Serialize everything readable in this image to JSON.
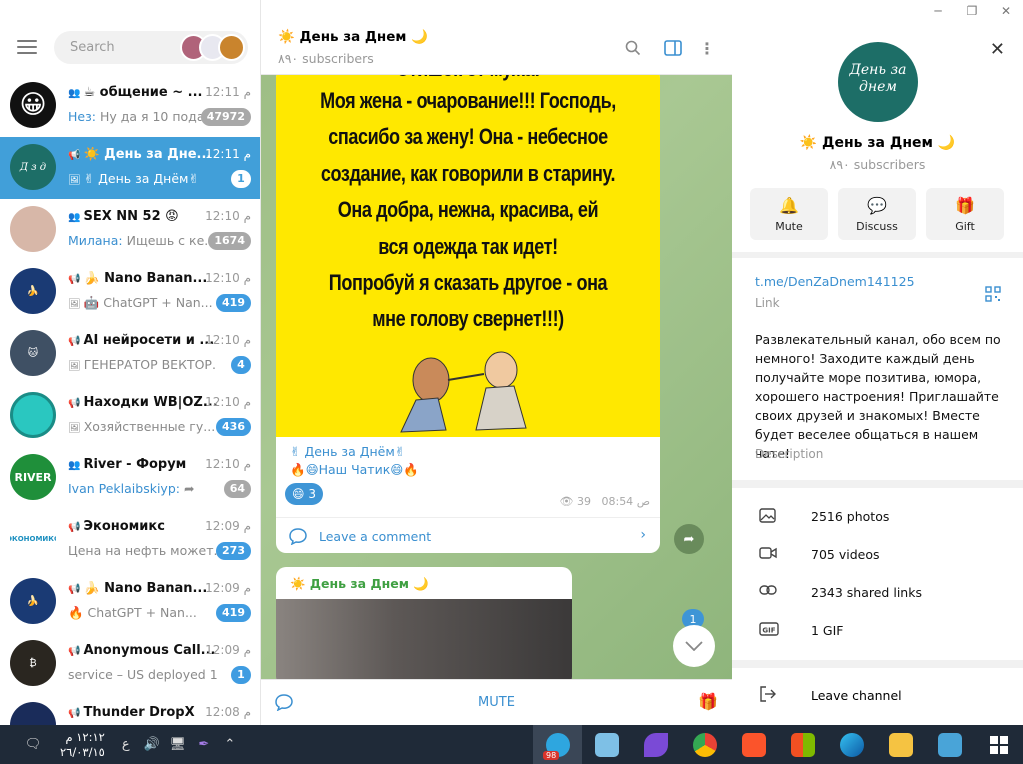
{
  "window": {
    "min": "─",
    "restore": "❐",
    "close": "✕"
  },
  "sidebar": {
    "search_placeholder": "Search",
    "chats": [
      {
        "title": "☕ общение ~ ...",
        "time": "م 12:11",
        "sender": "Нез:",
        "preview": "Ну да я 10 пода...",
        "badge": "47972"
      },
      {
        "title": "☀️ День за Дне...",
        "time": "م 12:11",
        "sender": "",
        "preview": "✌ День за Днём✌",
        "badge": "1"
      },
      {
        "title": "SEX NN 52 😡",
        "time": "م 12:10",
        "sender": "Милана:",
        "preview": "Ищешь с ке...",
        "badge": "1674"
      },
      {
        "title": "🍌 Nano Banan...",
        "time": "م 12:10",
        "sender": "",
        "preview": "🤖 ChatGPT + Nan...",
        "badge": "419"
      },
      {
        "title": "AI нейросети и ...",
        "time": "م 12:10",
        "sender": "",
        "preview": "ГЕНЕРАТОР ВЕКТОР...",
        "badge": "4"
      },
      {
        "title": "Находки WB|OZ...",
        "time": "م 12:10",
        "sender": "",
        "preview": "Хозяйственные гу...",
        "badge": "436"
      },
      {
        "title": "River - Форум",
        "time": "م 12:10",
        "sender": "Ivan Peklaibskiyp:",
        "preview": "",
        "badge": "64"
      },
      {
        "title": "Экономикс",
        "time": "م 12:09",
        "sender": "",
        "preview": "Цена на нефть может...",
        "badge": "273"
      },
      {
        "title": "🍌 Nano Banan...",
        "time": "م 12:09",
        "sender": "",
        "preview": "🔥 ChatGPT + Nan...",
        "badge": "419"
      },
      {
        "title": "Anonymous Call...",
        "time": "م 12:09",
        "sender": "",
        "preview": "service – US deployed 10...",
        "badge": "1"
      },
      {
        "title": "Thunder DropX",
        "time": "م 12:08",
        "sender": "",
        "preview": "",
        "badge": ""
      }
    ]
  },
  "channel": {
    "title": "☀️ День за Днем 🌙",
    "subscribers": "٨٩٠ subscribers",
    "meme_lines": [
      "Стишок от мужа:",
      "Моя жена - очарование!!! Господь,",
      "спасибо за жену! Она - небесное",
      "создание, как говорили в старину.",
      "Она добра, нежна, красива, ей",
      "вся одежда так идет!",
      "Попробуй я сказать другое - она",
      "мне голову свернет!!!)"
    ],
    "caption_line1": "✌ День за Днём✌",
    "caption_line2": "🔥😄Наш Чатик😄🔥",
    "reaction": "😄 3",
    "views": "39",
    "time": "08:54 ص",
    "comment": "Leave a comment",
    "second_post_title": "☀️ День за Днем 🌙",
    "unread_count": "1",
    "mute": "MUTE"
  },
  "info": {
    "name": "☀️ День за Днем 🌙",
    "subscribers": "٨٩٠ subscribers",
    "avatar_text": "День за днем",
    "buttons": {
      "mute": "Mute",
      "discuss": "Discuss",
      "gift": "Gift"
    },
    "link": "t.me/DenZaDnem141125",
    "link_label": "Link",
    "description": "Развлекательный канал, обо всем по немного! Заходите каждый день получайте море позитива, юмора, хорошего настроения! Приглашайте своих друзей и знакомых!  Вместе будет веселее общаться в нашем чате!",
    "description_label": "Description",
    "media": [
      {
        "icon": "photo-icon",
        "label": "2516 photos"
      },
      {
        "icon": "video-icon",
        "label": "705 videos"
      },
      {
        "icon": "link-icon",
        "label": "2343 shared links"
      },
      {
        "icon": "gif-icon",
        "label": "1 GIF"
      }
    ],
    "leave": "Leave channel"
  },
  "taskbar": {
    "time": "١٢:١٢ م",
    "date": "٢٦/٠٣/١٥",
    "lang": "ع",
    "telegram_badge": "98"
  }
}
